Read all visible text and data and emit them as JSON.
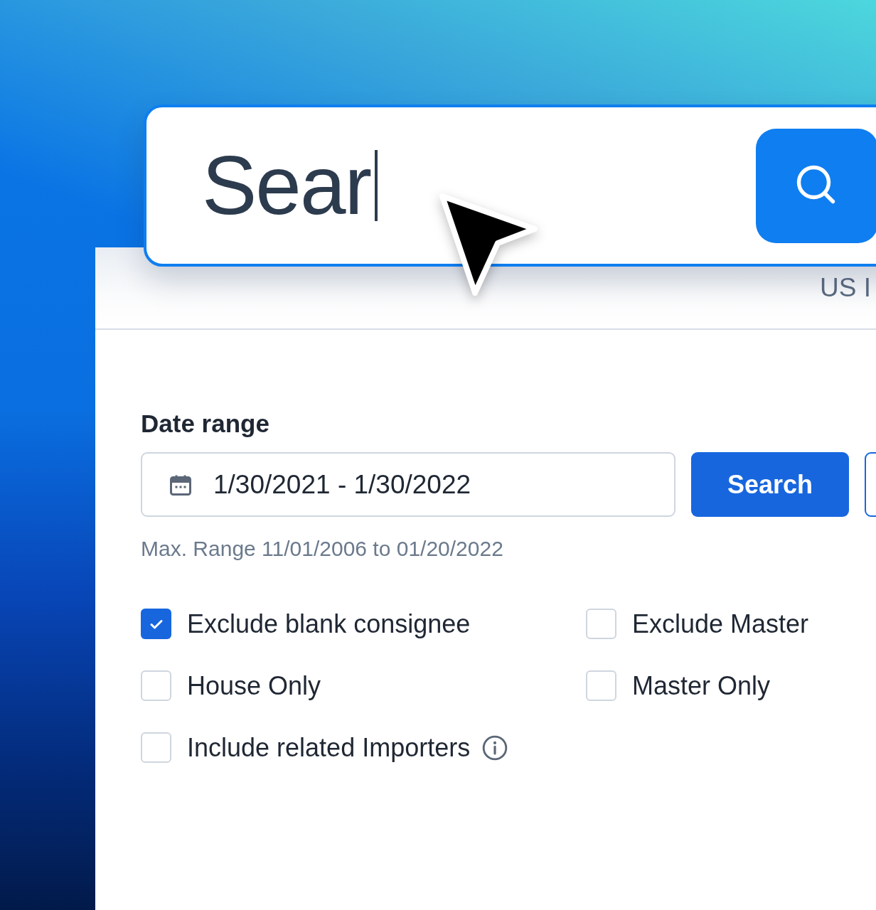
{
  "search_bar": {
    "value": "Sear"
  },
  "header": {
    "title": "US I"
  },
  "date_range": {
    "label": "Date range",
    "value": "1/30/2021 - 1/30/2022",
    "hint": "Max. Range 11/01/2006 to 01/20/2022"
  },
  "buttons": [
    {
      "kind": "primary",
      "label": "Search"
    },
    {
      "kind": "outline"
    }
  ],
  "options": [
    {
      "label": "Exclude blank consignee",
      "checked": true,
      "info": false
    },
    {
      "label": "Exclude Master",
      "checked": false,
      "info": false
    },
    {
      "label": "House Only",
      "checked": false,
      "info": false
    },
    {
      "label": "Master Only",
      "checked": false,
      "info": false
    },
    {
      "label": "Include related Importers",
      "checked": false,
      "info": true
    }
  ]
}
